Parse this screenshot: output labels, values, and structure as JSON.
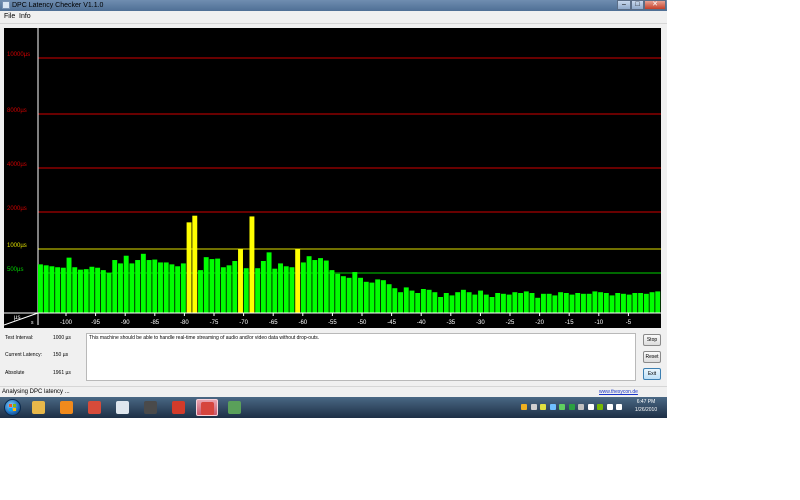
{
  "window": {
    "title": "DPC Latency Checker V1.1.0",
    "controls": {
      "minimize": "–",
      "maximize": "□",
      "close": "✕"
    }
  },
  "menu": [
    {
      "label": "File"
    },
    {
      "label": "Info"
    }
  ],
  "chart_data": {
    "type": "bar",
    "y_unit": "µs",
    "x_unit": "s",
    "y_gridlines": [
      {
        "label": "10000µs",
        "color": "#d10000"
      },
      {
        "label": "8000µs",
        "color": "#d10000"
      },
      {
        "label": "4000µs",
        "color": "#d10000"
      },
      {
        "label": "2000µs",
        "color": "#d10000"
      },
      {
        "label": "1000µs",
        "color": "#e0e000"
      },
      {
        "label": "500µs",
        "color": "#00d000"
      }
    ],
    "x_ticks": [
      "-100",
      "-95",
      "-90",
      "-85",
      "-80",
      "-75",
      "-70",
      "-65",
      "-60",
      "-55",
      "-50",
      "-45",
      "-40",
      "-35",
      "-30",
      "-25",
      "-20",
      "-15",
      "-10",
      "-5"
    ],
    "green_threshold": 1000,
    "colors": {
      "green": "#00ff00",
      "yellow": "#ffff00"
    },
    "values": [
      680,
      660,
      640,
      620,
      610,
      820,
      620,
      570,
      580,
      630,
      610,
      560,
      500,
      770,
      700,
      860,
      700,
      770,
      900,
      770,
      780,
      720,
      720,
      680,
      640,
      700,
      1720,
      1900,
      560,
      830,
      790,
      800,
      620,
      660,
      750,
      1000,
      600,
      1880,
      600,
      750,
      930,
      590,
      700,
      640,
      620,
      1000,
      720,
      850,
      770,
      810,
      760,
      560,
      490,
      460,
      440,
      520,
      440,
      390,
      380,
      420,
      410,
      360,
      310,
      260,
      320,
      280,
      250,
      300,
      290,
      260,
      200,
      250,
      220,
      260,
      290,
      260,
      230,
      280,
      230,
      200,
      250,
      240,
      230,
      260,
      250,
      270,
      250,
      190,
      240,
      240,
      220,
      260,
      250,
      230,
      250,
      240,
      240,
      270,
      260,
      250,
      220,
      250,
      240,
      230,
      250,
      250,
      240,
      260,
      270
    ]
  },
  "info": {
    "test_interval_label": "Test Interval:",
    "test_interval_value": "1000 µs",
    "current_latency_label": "Current Latency:",
    "current_latency_value": "150 µs",
    "absolute_label": "Absolute",
    "absolute_value": "1961 µs"
  },
  "message": "This machine should be able to handle real-time streaming of audio and/or video data without drop-outs.",
  "buttons": {
    "stop": "Stop",
    "reset": "Reset",
    "exit": "Exit"
  },
  "status": {
    "text": "Analysing DPC latency ...",
    "link": "www.thesycon.de"
  },
  "taskbar": {
    "time": "6:47 PM",
    "date": "1/26/2010",
    "apps": [
      {
        "icon": "explorer-folder-icon",
        "color": "#e8b84a"
      },
      {
        "icon": "media-player-icon",
        "color": "#f08a1c"
      },
      {
        "icon": "chrome-icon",
        "color": "#d64b3a"
      },
      {
        "icon": "fan-app-icon",
        "color": "#dfe6ee"
      },
      {
        "icon": "burn-app-icon",
        "color": "#4a4a4a"
      },
      {
        "icon": "ccleaner-icon",
        "color": "#d33b2a"
      },
      {
        "icon": "dpc-checker-icon",
        "color": "#d6453e"
      },
      {
        "icon": "monitor-app-icon",
        "color": "#5aa05a"
      }
    ],
    "tray": [
      {
        "icon": "tray-app-1-icon",
        "color": "#f0b020"
      },
      {
        "icon": "tray-app-2-icon",
        "color": "#d0d0d0"
      },
      {
        "icon": "tray-app-3-icon",
        "color": "#e0e040"
      },
      {
        "icon": "tray-app-4-icon",
        "color": "#70c0ff"
      },
      {
        "icon": "tray-app-5-icon",
        "color": "#60d060"
      },
      {
        "icon": "tray-app-6-icon",
        "color": "#2aa040"
      },
      {
        "icon": "tray-app-7-icon",
        "color": "#c0c0c0"
      },
      {
        "icon": "action-center-flag-icon",
        "color": "#ffffff"
      },
      {
        "icon": "nvidia-icon",
        "color": "#76b900"
      },
      {
        "icon": "network-signal-icon",
        "color": "#ffffff"
      },
      {
        "icon": "volume-icon",
        "color": "#ffffff"
      }
    ]
  }
}
